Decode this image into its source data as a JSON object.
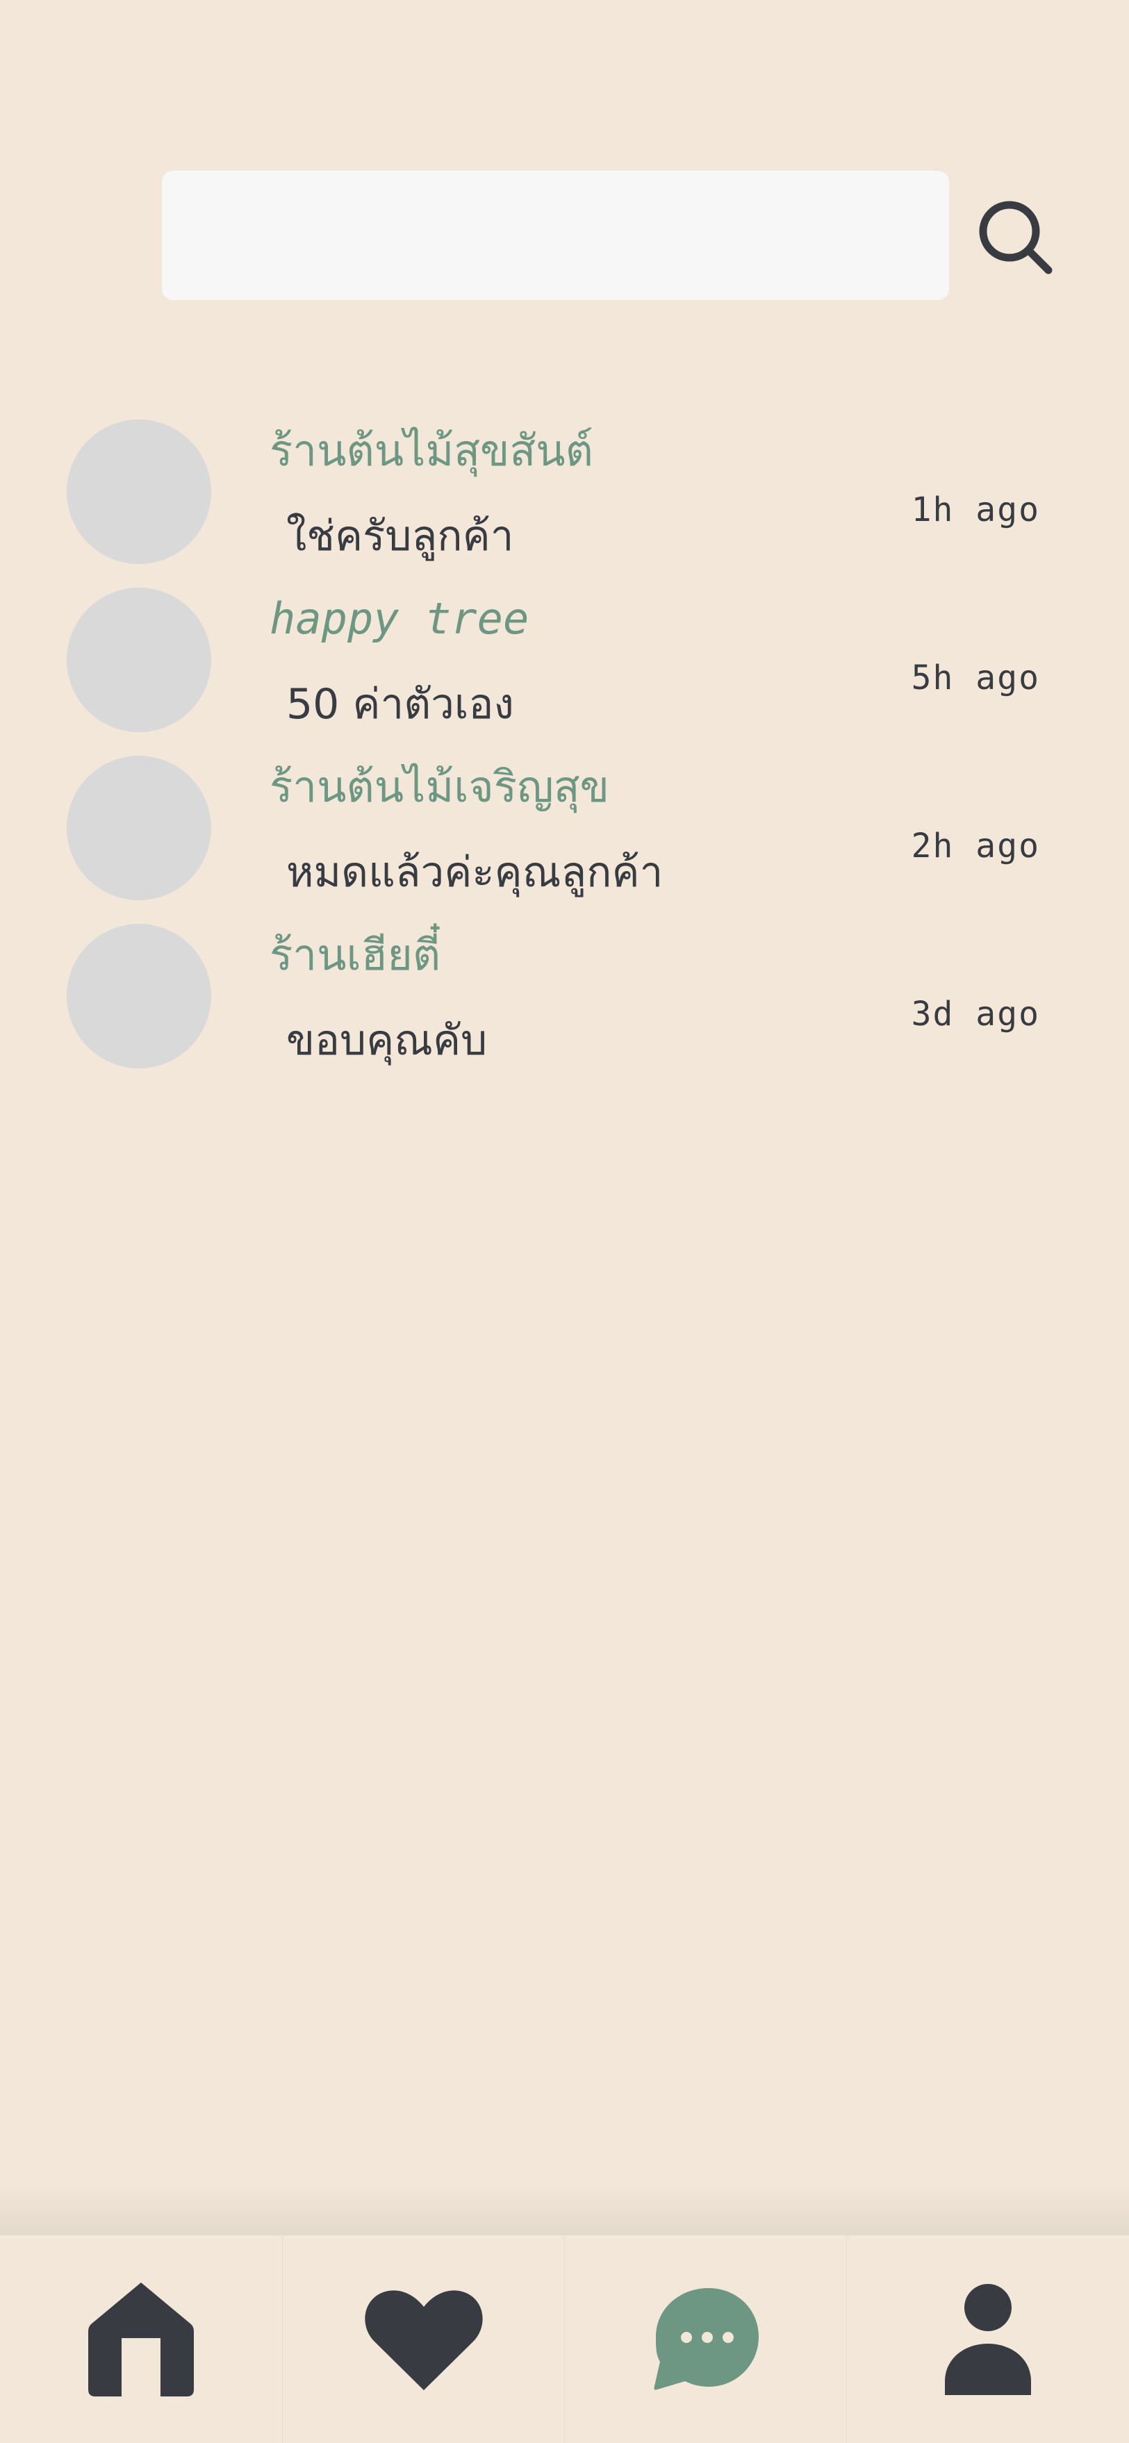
{
  "search": {
    "value": "",
    "placeholder": ""
  },
  "chats": [
    {
      "shop_name": "ร้านต้นไม้สุขสันต์",
      "last_message": "ใช่ครับลูกค้า",
      "time": "1h ago"
    },
    {
      "shop_name": "happy tree",
      "last_message": "50 ค่าตัวเอง",
      "time": "5h ago"
    },
    {
      "shop_name": "ร้านต้นไม้เจริญสุข",
      "last_message": "หมดแล้วค่ะคุณลูกค้า",
      "time": "2h ago"
    },
    {
      "shop_name": "ร้านเฮียตี๋",
      "last_message": "ขอบคุณคับ",
      "time": "3d ago"
    }
  ],
  "nav": {
    "items": [
      {
        "icon": "home-icon",
        "active": false
      },
      {
        "icon": "heart-icon",
        "active": false
      },
      {
        "icon": "chat-icon",
        "active": true
      },
      {
        "icon": "profile-icon",
        "active": false
      }
    ],
    "active_color": "#6d9683",
    "inactive_color": "#383b42"
  },
  "colors": {
    "background": "#f2e7d8",
    "accent": "#6d9683",
    "text": "#383b42",
    "avatar_placeholder": "#d9d9d9",
    "search_field": "#f7f7f7"
  }
}
